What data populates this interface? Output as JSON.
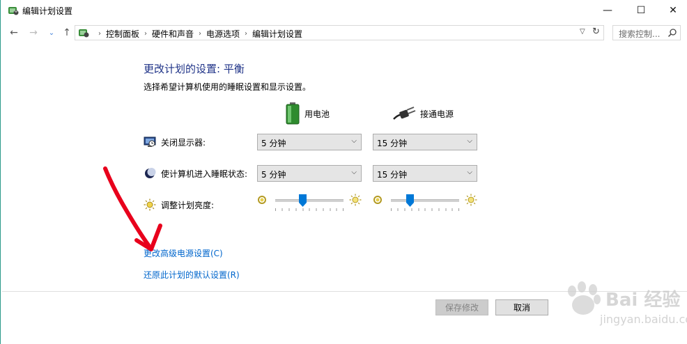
{
  "window": {
    "title": "编辑计划设置",
    "controls": {
      "minimize": "—",
      "maximize": "☐",
      "close": "✕"
    }
  },
  "address_bar": {
    "breadcrumbs": [
      "控制面板",
      "硬件和声音",
      "电源选项",
      "编辑计划设置"
    ],
    "search_placeholder": "搜索控制..."
  },
  "main": {
    "heading": "更改计划的设置: 平衡",
    "subheading": "选择希望计算机使用的睡眠设置和显示设置。",
    "columns": {
      "battery": "用电池",
      "plugged_in": "接通电源"
    },
    "rows": [
      {
        "label": "关闭显示器:",
        "battery_value": "5 分钟",
        "plugged_value": "15 分钟"
      },
      {
        "label": "使计算机进入睡眠状态:",
        "battery_value": "5 分钟",
        "plugged_value": "15 分钟"
      }
    ],
    "brightness": {
      "label": "调整计划亮度:",
      "battery_level": 0.4,
      "plugged_level": 0.28
    },
    "links": {
      "advanced": "更改高级电源设置(C)",
      "restore": "还原此计划的默认设置(R)"
    }
  },
  "footer": {
    "save_label": "保存修改",
    "cancel_label": "取消"
  },
  "colors": {
    "heading": "#1e3287",
    "link": "#0066cc",
    "annotation_arrow": "#e8001c"
  },
  "watermark": {
    "brand": "Bai 经验",
    "url": "jingyan.baidu.com"
  }
}
